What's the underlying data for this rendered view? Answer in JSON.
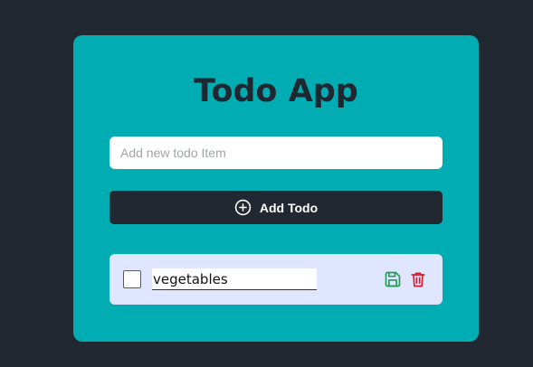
{
  "app": {
    "title": "Todo App"
  },
  "new_todo": {
    "placeholder": "Add new todo Item",
    "value": ""
  },
  "add_button": {
    "label": "Add Todo",
    "icon": "plus-circle-icon"
  },
  "todos": [
    {
      "text": "vegetables",
      "completed": false,
      "save_icon": "floppy-disk-icon",
      "delete_icon": "trash-icon"
    }
  ],
  "colors": {
    "background": "#222831",
    "card": "#01acb3",
    "title": "#1f2731",
    "button": "#222831",
    "todo_item_bg": "#e0e6ff",
    "save_icon": "#1f9d55",
    "delete_icon": "#d71b2c"
  }
}
